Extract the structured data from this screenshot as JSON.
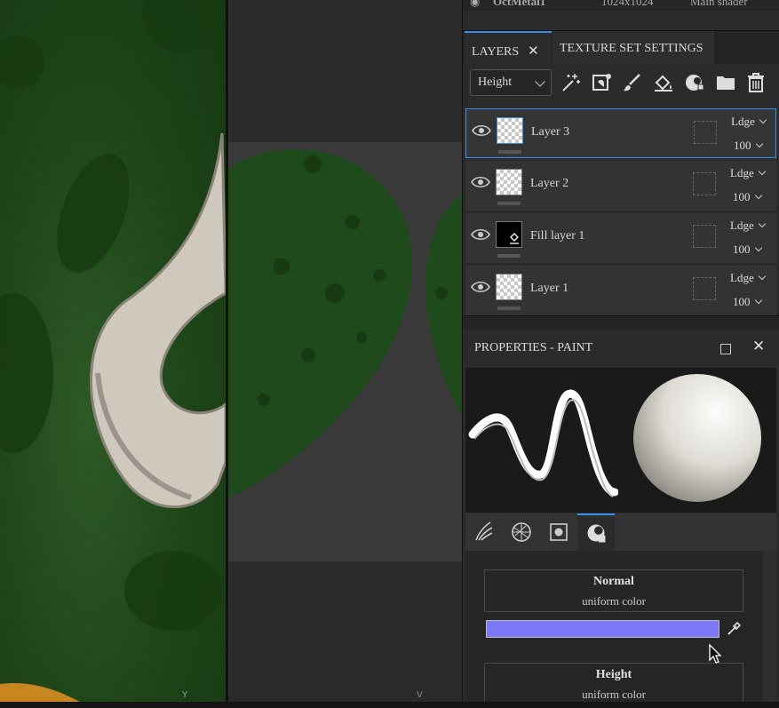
{
  "topinfo": {
    "name": "OctMetal1",
    "resolution": "1024x1024",
    "shader": "Main shader"
  },
  "tabs": [
    {
      "label": "LAYERS",
      "close": "✕"
    },
    {
      "label": "TEXTURE SET SETTINGS"
    }
  ],
  "toolbar": {
    "channel_select": "Height",
    "buttons": [
      "add-effect-icon",
      "add-mask-icon",
      "add-paint-layer-icon",
      "add-fill-layer-icon",
      "add-smart-material-icon",
      "add-folder-icon",
      "delete-icon"
    ]
  },
  "layers": [
    {
      "name": "Layer 3",
      "blend": "Ldge",
      "opacity": "100",
      "thumb": "checker",
      "selected": true
    },
    {
      "name": "Layer 2",
      "blend": "Ldge",
      "opacity": "100",
      "thumb": "checker",
      "selected": false
    },
    {
      "name": "Fill layer 1",
      "blend": "Ldge",
      "opacity": "100",
      "thumb": "black",
      "selected": false
    },
    {
      "name": "Layer 1",
      "blend": "Ldge",
      "opacity": "100",
      "thumb": "checker",
      "selected": false
    }
  ],
  "properties": {
    "title": "PROPERTIES - PAINT",
    "tabs": [
      "brush-stroke-icon",
      "material-icon",
      "mask-icon",
      "channel-icon"
    ],
    "channels": [
      {
        "name": "Normal",
        "sub": "uniform color",
        "color": "#7b79f7"
      },
      {
        "name": "Height",
        "sub": "uniform color"
      }
    ]
  },
  "viewport": {
    "axis_3d": "Y",
    "axis_2d": "V"
  },
  "colors": {
    "accent": "#3a8ee6",
    "normal_swatch": "#7b79f7"
  }
}
